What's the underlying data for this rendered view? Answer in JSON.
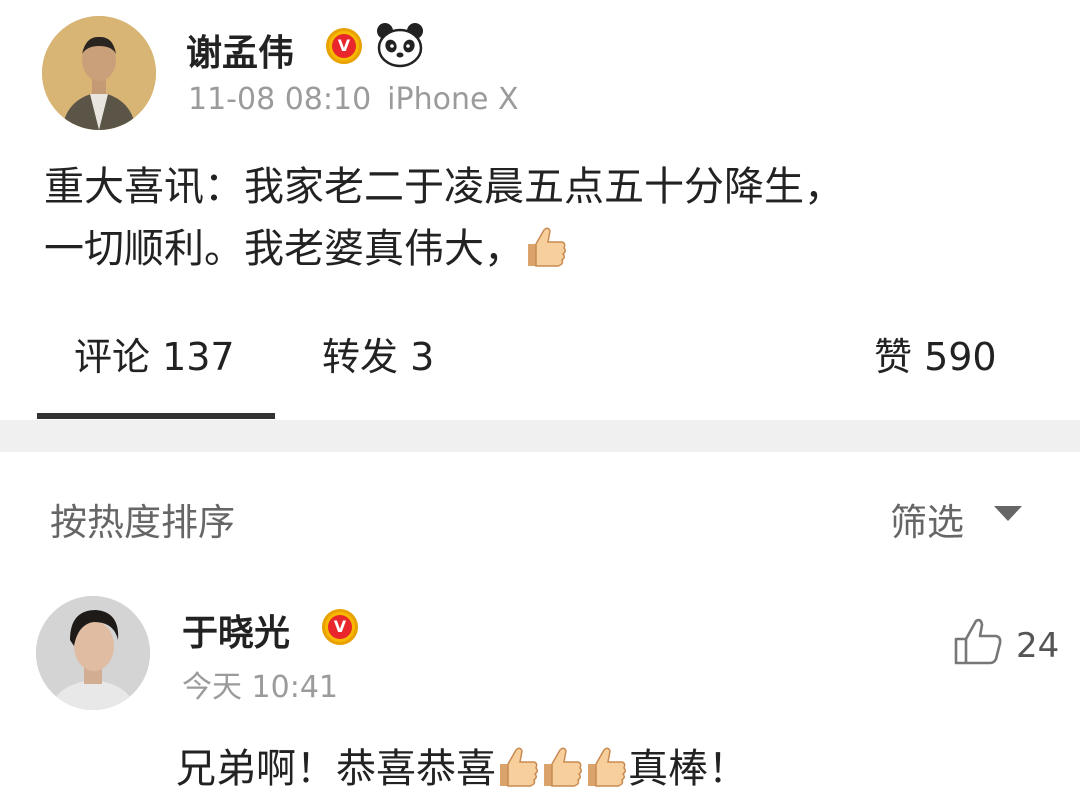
{
  "post": {
    "author": "谢孟伟",
    "time": "11-08 08:10",
    "device": "iPhone X",
    "text_line1": "重大喜讯：我家老二于凌晨五点五十分降生，",
    "text_line2": "一切顺利。我老婆真伟大，",
    "avatar_icon": "person-avatar",
    "badge_icon": "verified-v-badge",
    "emoji_icon": "panda-emoji"
  },
  "tabs": {
    "comments_label": "评论 137",
    "reposts_label": "转发 3",
    "likes_label": "赞 590"
  },
  "sort": {
    "label": "按热度排序",
    "filter_label": "筛选"
  },
  "comment": {
    "author": "于晓光",
    "time": "今天 10:41",
    "likes": "24",
    "text_part1": "兄弟啊！恭喜恭喜",
    "text_part2": "真棒！",
    "thumbs_count": 3
  },
  "colors": {
    "badge_orange": "#f6b900",
    "badge_red": "#e8262b",
    "meta_gray": "#9b9b9b",
    "band_gray": "#f0f0f0"
  }
}
